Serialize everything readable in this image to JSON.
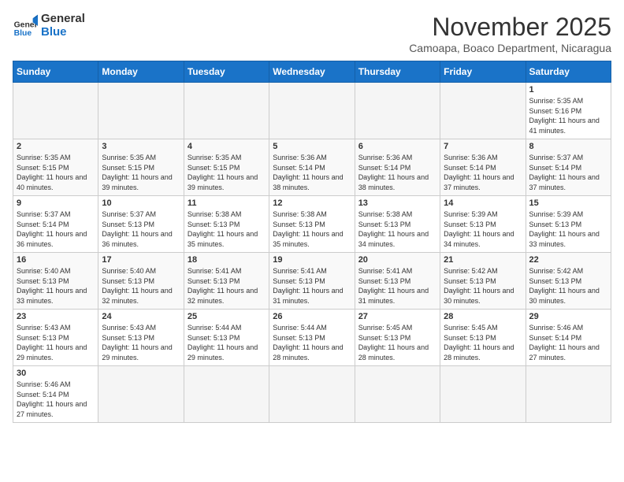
{
  "header": {
    "logo_general": "General",
    "logo_blue": "Blue",
    "month_title": "November 2025",
    "location": "Camoapa, Boaco Department, Nicaragua"
  },
  "weekdays": [
    "Sunday",
    "Monday",
    "Tuesday",
    "Wednesday",
    "Thursday",
    "Friday",
    "Saturday"
  ],
  "days": {
    "1": {
      "sunrise": "5:35 AM",
      "sunset": "5:16 PM",
      "daylight": "11 hours and 41 minutes."
    },
    "2": {
      "sunrise": "5:35 AM",
      "sunset": "5:15 PM",
      "daylight": "11 hours and 40 minutes."
    },
    "3": {
      "sunrise": "5:35 AM",
      "sunset": "5:15 PM",
      "daylight": "11 hours and 39 minutes."
    },
    "4": {
      "sunrise": "5:35 AM",
      "sunset": "5:15 PM",
      "daylight": "11 hours and 39 minutes."
    },
    "5": {
      "sunrise": "5:36 AM",
      "sunset": "5:14 PM",
      "daylight": "11 hours and 38 minutes."
    },
    "6": {
      "sunrise": "5:36 AM",
      "sunset": "5:14 PM",
      "daylight": "11 hours and 38 minutes."
    },
    "7": {
      "sunrise": "5:36 AM",
      "sunset": "5:14 PM",
      "daylight": "11 hours and 37 minutes."
    },
    "8": {
      "sunrise": "5:37 AM",
      "sunset": "5:14 PM",
      "daylight": "11 hours and 37 minutes."
    },
    "9": {
      "sunrise": "5:37 AM",
      "sunset": "5:14 PM",
      "daylight": "11 hours and 36 minutes."
    },
    "10": {
      "sunrise": "5:37 AM",
      "sunset": "5:13 PM",
      "daylight": "11 hours and 36 minutes."
    },
    "11": {
      "sunrise": "5:38 AM",
      "sunset": "5:13 PM",
      "daylight": "11 hours and 35 minutes."
    },
    "12": {
      "sunrise": "5:38 AM",
      "sunset": "5:13 PM",
      "daylight": "11 hours and 35 minutes."
    },
    "13": {
      "sunrise": "5:38 AM",
      "sunset": "5:13 PM",
      "daylight": "11 hours and 34 minutes."
    },
    "14": {
      "sunrise": "5:39 AM",
      "sunset": "5:13 PM",
      "daylight": "11 hours and 34 minutes."
    },
    "15": {
      "sunrise": "5:39 AM",
      "sunset": "5:13 PM",
      "daylight": "11 hours and 33 minutes."
    },
    "16": {
      "sunrise": "5:40 AM",
      "sunset": "5:13 PM",
      "daylight": "11 hours and 33 minutes."
    },
    "17": {
      "sunrise": "5:40 AM",
      "sunset": "5:13 PM",
      "daylight": "11 hours and 32 minutes."
    },
    "18": {
      "sunrise": "5:41 AM",
      "sunset": "5:13 PM",
      "daylight": "11 hours and 32 minutes."
    },
    "19": {
      "sunrise": "5:41 AM",
      "sunset": "5:13 PM",
      "daylight": "11 hours and 31 minutes."
    },
    "20": {
      "sunrise": "5:41 AM",
      "sunset": "5:13 PM",
      "daylight": "11 hours and 31 minutes."
    },
    "21": {
      "sunrise": "5:42 AM",
      "sunset": "5:13 PM",
      "daylight": "11 hours and 30 minutes."
    },
    "22": {
      "sunrise": "5:42 AM",
      "sunset": "5:13 PM",
      "daylight": "11 hours and 30 minutes."
    },
    "23": {
      "sunrise": "5:43 AM",
      "sunset": "5:13 PM",
      "daylight": "11 hours and 29 minutes."
    },
    "24": {
      "sunrise": "5:43 AM",
      "sunset": "5:13 PM",
      "daylight": "11 hours and 29 minutes."
    },
    "25": {
      "sunrise": "5:44 AM",
      "sunset": "5:13 PM",
      "daylight": "11 hours and 29 minutes."
    },
    "26": {
      "sunrise": "5:44 AM",
      "sunset": "5:13 PM",
      "daylight": "11 hours and 28 minutes."
    },
    "27": {
      "sunrise": "5:45 AM",
      "sunset": "5:13 PM",
      "daylight": "11 hours and 28 minutes."
    },
    "28": {
      "sunrise": "5:45 AM",
      "sunset": "5:13 PM",
      "daylight": "11 hours and 28 minutes."
    },
    "29": {
      "sunrise": "5:46 AM",
      "sunset": "5:14 PM",
      "daylight": "11 hours and 27 minutes."
    },
    "30": {
      "sunrise": "5:46 AM",
      "sunset": "5:14 PM",
      "daylight": "11 hours and 27 minutes."
    }
  }
}
